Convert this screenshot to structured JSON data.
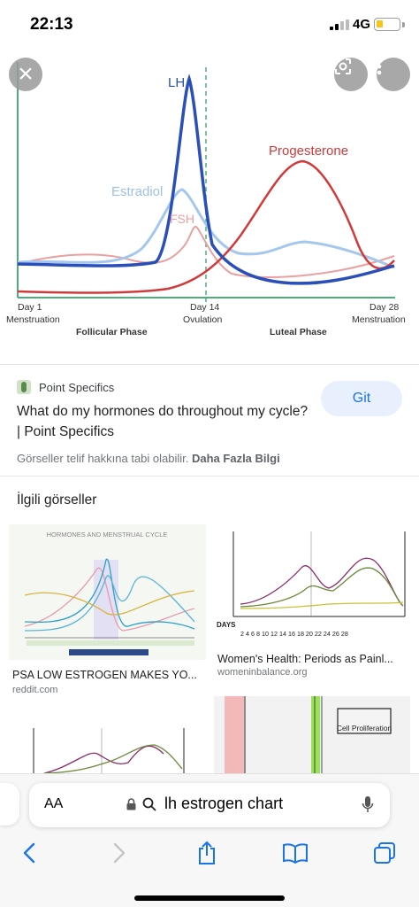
{
  "status_bar": {
    "time": "22:13",
    "network": "4G"
  },
  "main_image": {
    "labels": {
      "lh": "LH",
      "progesterone": "Progesterone",
      "estradiol": "Estradiol",
      "fsh": "FSH",
      "day1": "Day 1",
      "menstruation_left": "Menstruation",
      "day14": "Day 14",
      "ovulation": "Ovulation",
      "day28": "Day 28",
      "menstruation_right": "Menstruation",
      "follicular": "Follicular Phase",
      "luteal": "Luteal Phase"
    },
    "colors": {
      "lh": "#2a4fb8",
      "progesterone": "#d23a3a",
      "estradiol": "#9cc0e8",
      "fsh": "#eaa0a0",
      "ovulation_line": "#4caf7a"
    }
  },
  "result": {
    "source": "Point Specifics",
    "title": "What do my hormones do throughout my cycle? | Point Specifics",
    "copyright_notice": "Görseller telif hakkına tabi olabilir.",
    "more_info": "Daha Fazla Bilgi",
    "visit_button": "Git"
  },
  "related": {
    "heading": "İlgili görseller",
    "items": [
      {
        "thumb_title": "HORMONES AND MENSTRUAL CYCLE",
        "caption": "PSA LOW ESTROGEN MAKES YO...",
        "source": "reddit.com"
      },
      {
        "thumb_axis_label": "DAYS",
        "thumb_days": "2 4 6 8 10 12 14 16 18 20 22 24 26 28",
        "caption": "Women's Health: Periods as Painl...",
        "source": "womeninbalance.org"
      },
      {
        "caption": "",
        "source": ""
      },
      {
        "thumb_box_label": "Cell Proliferation",
        "caption": "",
        "source": ""
      }
    ]
  },
  "browser": {
    "aa_label": "AA",
    "address": "lh estrogen chart"
  }
}
